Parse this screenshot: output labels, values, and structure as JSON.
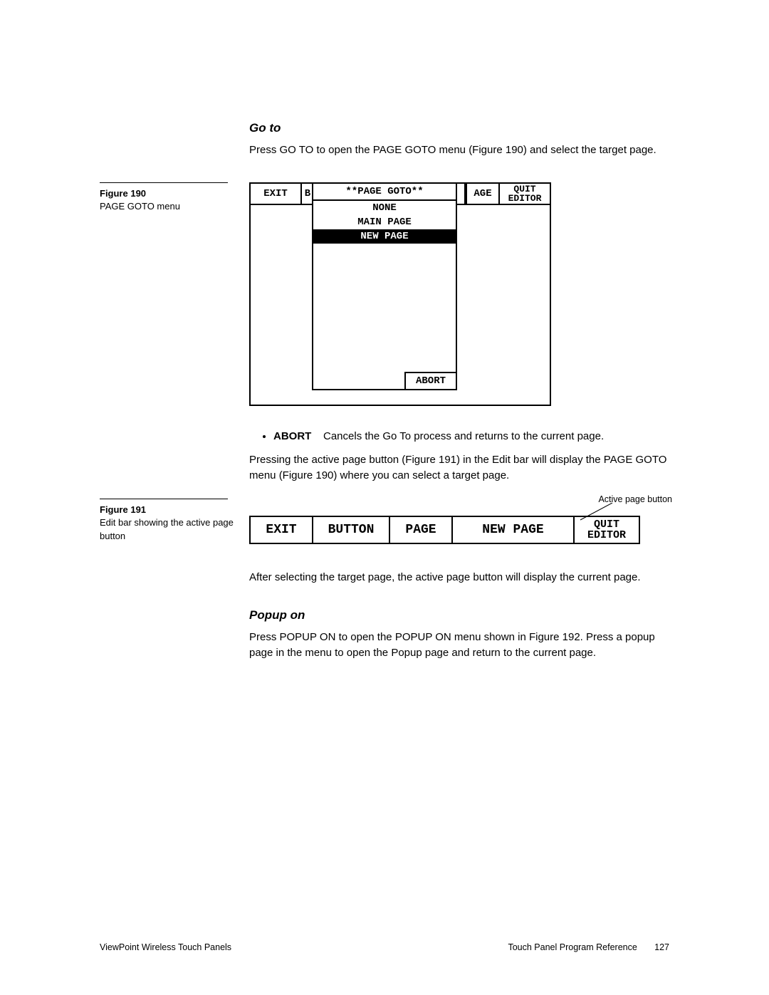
{
  "section1": {
    "title": "Go to",
    "intro": "Press GO TO to open the PAGE GOTO menu (Figure 190) and select the target page."
  },
  "fig190": {
    "label": "Figure 190",
    "caption": "PAGE GOTO menu",
    "toolbar": {
      "exit": "EXIT",
      "b": "B",
      "age": "AGE",
      "quit1": "QUIT",
      "quit2": "EDITOR"
    },
    "menu": {
      "title": "**PAGE GOTO**",
      "items": [
        "NONE",
        "MAIN PAGE",
        "NEW PAGE"
      ],
      "abort": "ABORT"
    }
  },
  "abort_item": {
    "label": "ABORT",
    "desc": "Cancels the Go To process and returns to the current page."
  },
  "para_after_abort": "Pressing the active page button (Figure 191) in the Edit bar will display the PAGE GOTO menu (Figure 190) where you can select a target page.",
  "fig191": {
    "label": "Figure 191",
    "caption": "Edit bar showing the active page button",
    "callout": "Active page button",
    "cells": {
      "exit": "EXIT",
      "button": "BUTTON",
      "page": "PAGE",
      "newpage": "NEW PAGE",
      "quit1": "QUIT",
      "quit2": "EDITOR"
    }
  },
  "para_after_191": "After selecting the target page, the active page button will display the current page.",
  "section2": {
    "title": "Popup on",
    "body": "Press POPUP ON to open the POPUP ON menu shown in Figure 192. Press a popup page in the menu to open the Popup page and return to the current page."
  },
  "footer": {
    "left": "ViewPoint Wireless Touch Panels",
    "right_label": "Touch Panel Program Reference",
    "page": "127"
  }
}
